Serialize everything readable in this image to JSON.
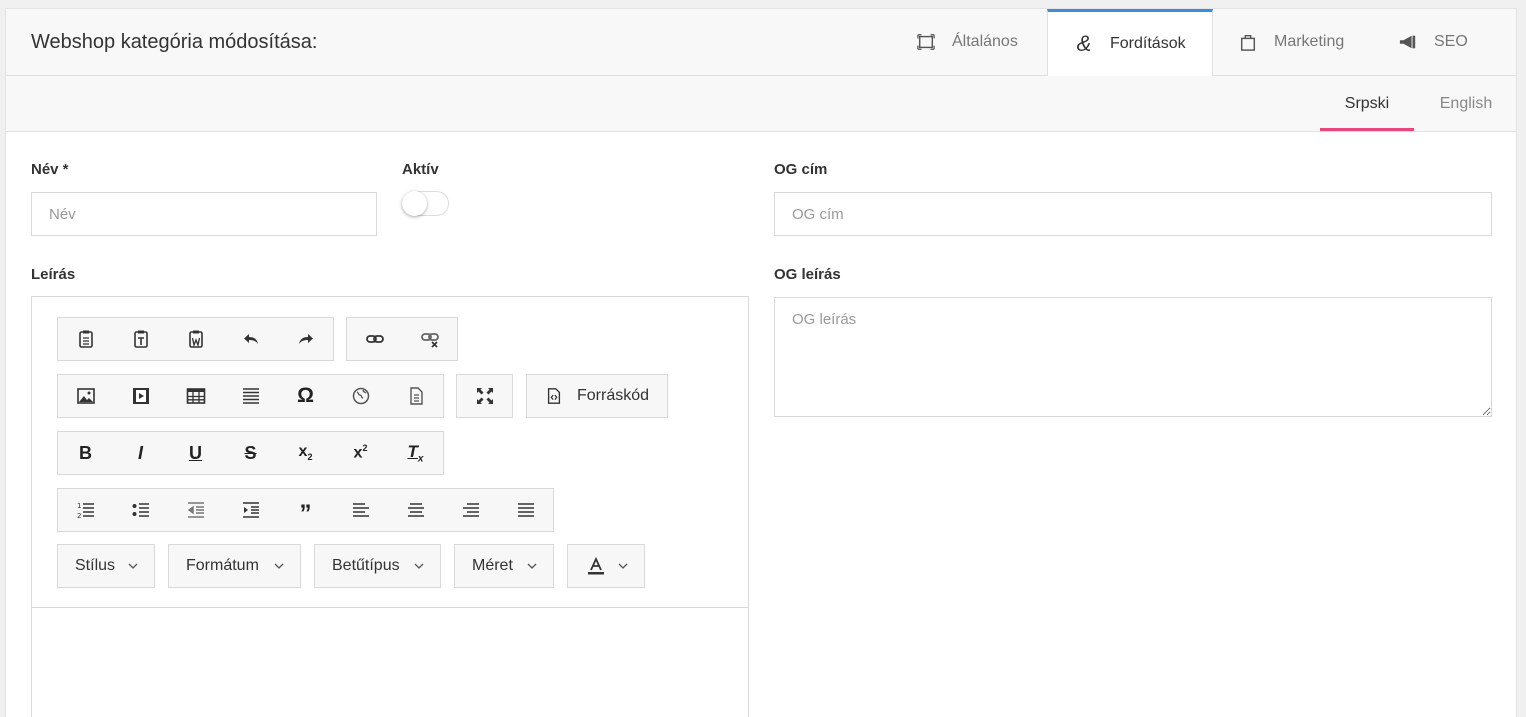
{
  "header": {
    "title": "Webshop kategória módosítása:",
    "tabs": [
      {
        "label": "Általános",
        "icon": "frame-icon"
      },
      {
        "label": "Fordítások",
        "icon": "ampersand-icon",
        "active": true
      },
      {
        "label": "Marketing",
        "icon": "shopping-bag-icon"
      },
      {
        "label": "SEO",
        "icon": "megaphone-icon"
      }
    ]
  },
  "languages": [
    {
      "label": "Srpski",
      "active": true
    },
    {
      "label": "English"
    }
  ],
  "form": {
    "name_label": "Név *",
    "name_placeholder": "Név",
    "active_label": "Aktív",
    "active_value": false,
    "og_title_label": "OG cím",
    "og_title_placeholder": "OG cím",
    "description_label": "Leírás",
    "og_description_label": "OG leírás",
    "og_description_placeholder": "OG leírás"
  },
  "toolbar": {
    "source_label": "Forráskód",
    "dropdowns": {
      "style": "Stílus",
      "format": "Formátum",
      "font": "Betűtípus",
      "size": "Méret"
    }
  },
  "colors": {
    "accent_tab": "#3a8dde",
    "accent_lang": "#e8467c"
  }
}
